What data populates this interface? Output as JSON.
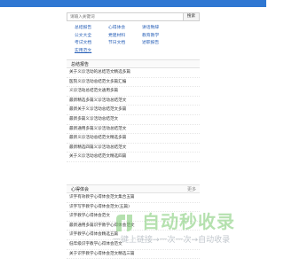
{
  "colors": {
    "brand": "#2f77d2",
    "link": "#2b62b8",
    "watermark": "#7ac86e"
  },
  "search": {
    "placeholder": "请输入关键词",
    "button": "搜索"
  },
  "categories": [
    {
      "label": "总结报告"
    },
    {
      "label": "心得体会"
    },
    {
      "label": "讲话致辞"
    },
    {
      "label": "公文大全"
    },
    {
      "label": "党建材料"
    },
    {
      "label": "教育教学"
    },
    {
      "label": "考试文档"
    },
    {
      "label": "节日文档"
    },
    {
      "label": "述职报告"
    },
    {
      "label": "实用范文"
    }
  ],
  "sections": [
    {
      "title": "总结报告",
      "more": "",
      "items": [
        "关于义诊活动的总结范文精选多篇",
        "医院义诊活动总结范文多篇汇编",
        "义诊活动总结范文通用多篇",
        "最新精选多篇义诊活动总结范文",
        "最新关于义诊活动总结范文多篇",
        "最新多篇义诊活动总结范文",
        "最新通用多篇义诊活动总结范文",
        "最新义诊活动总结范文精选多篇",
        "最新精选四篇义诊活动总结范文",
        "关于义诊活动总结范文精选四篇"
      ]
    },
    {
      "title": "心得体会",
      "more": "更多",
      "items": [
        "识字有效教学心得体会范文集合五篇",
        "识字写字教学心得体会范文(五篇)",
        "识字教学心得体会范文",
        "最新通用多篇识字教学心得体会范文",
        "识字教学心得体会精选五篇",
        "低年级识字教学心得体会范文",
        "关于识字教学心得体会范文精选三篇"
      ]
    }
  ],
  "watermark": {
    "title": "自动秒收录",
    "subtitle": "一键上链接→一次一次→自动收录",
    "logo_icon": "zidongmiaoshoulu-logo"
  }
}
